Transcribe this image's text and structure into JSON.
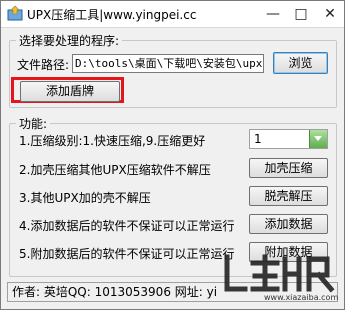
{
  "window": {
    "title": "UPX压缩工具|www.yingpei.cc"
  },
  "program_group": {
    "legend": "选择要处理的程序:",
    "path_label": "文件路径:",
    "path_value": "D:\\tools\\桌面\\下载吧\\安装包\\upx",
    "browse_label": "浏览",
    "add_shield_label": "添加盾牌"
  },
  "function_group": {
    "legend": "功能:",
    "compress_level_label": "1.压缩级别:1.快速压缩,9.压缩更好",
    "compress_level_value": "1",
    "row2_label": "2.加壳压缩其他UPX压缩软件不解压",
    "row2_button": "加壳压缩",
    "row3_label": "3.其他UPX加的壳不解压",
    "row3_button": "脱壳解压",
    "row4_label": "4.添加数据后的软件不保证可以正常运行",
    "row4_button": "添加数据",
    "row5_label": "5.附加数据后的软件不保证可以正常运行",
    "row5_button": "附加数据"
  },
  "statusbar": {
    "text": "作者: 英培QQ: 1013053906  网址: yi"
  },
  "watermark": {
    "text": "www.xiazaiba.com"
  },
  "colors": {
    "highlight": "#e8141c",
    "combo_arrow": "#5fae4f"
  }
}
